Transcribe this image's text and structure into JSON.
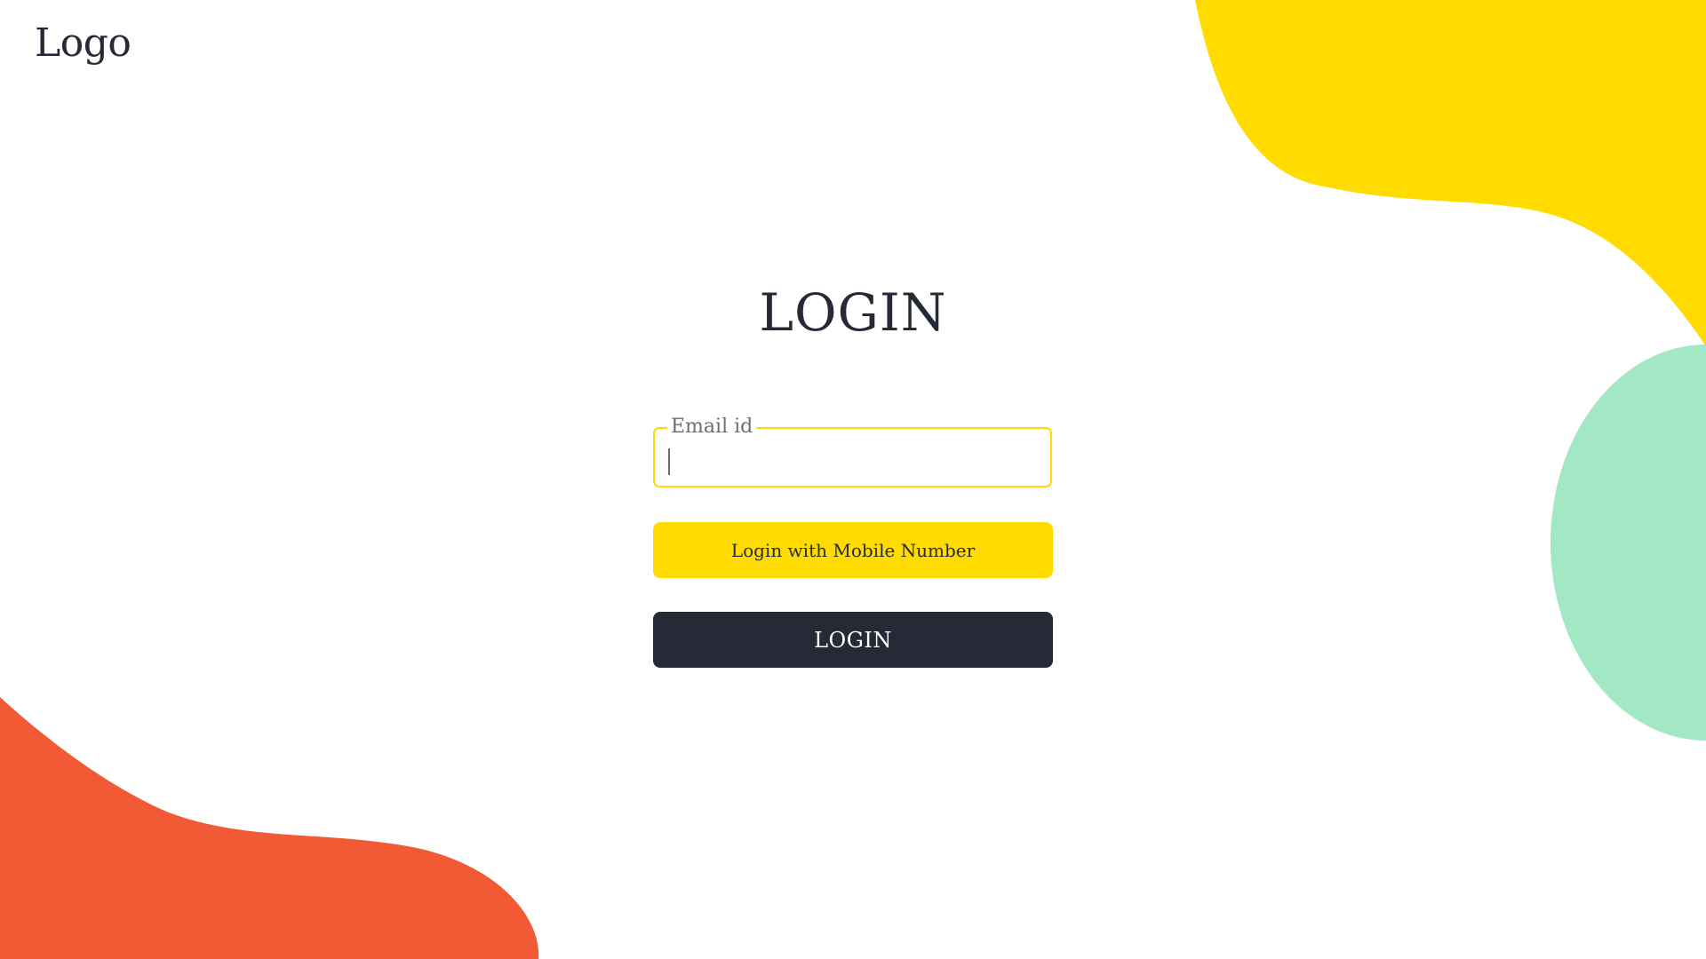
{
  "header": {
    "logo_text": "Logo"
  },
  "form": {
    "title": "LOGIN",
    "email_label": "Email id",
    "email_value": "",
    "mobile_button_label": "Login with Mobile Number",
    "login_button_label": "LOGIN"
  },
  "theme": {
    "accent_yellow": "#ffdb00",
    "accent_green": "#a2e8c4",
    "accent_orange": "#f15a35",
    "dark": "#262a37",
    "background": "#ffffff"
  }
}
